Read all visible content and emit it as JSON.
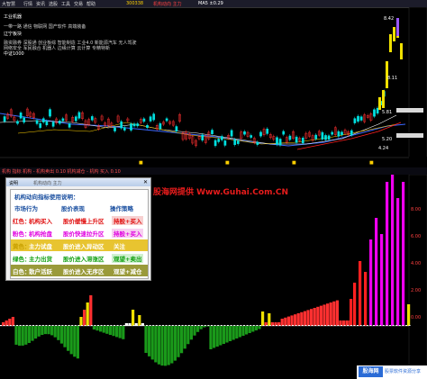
{
  "topbar": {
    "items": [
      "大智慧",
      "行情",
      "资讯",
      "选股",
      "工具",
      "交易",
      "帮助"
    ],
    "stock_code": "300338",
    "info": "机构动向 主力",
    "right_info": "MA5 ±0.29"
  },
  "upper": {
    "labels": [
      {
        "text": "工业机器",
        "color": "#ffffff"
      },
      {
        "text": "辽宁板块",
        "color": "#ffffff"
      },
      {
        "text": "中证1000",
        "color": "#ffffff"
      }
    ],
    "tag_lines": [
      "一带一路 通信 物联网 国产软件 高端装备",
      "融资融券 深股通 创业板综 智能制造 工业4.0 新能源汽车 无人驾驶",
      "网络安全 军民融合 机器人 边缘计算 云计算 专精特新"
    ],
    "price_labels": {
      "high": "8.42",
      "p1": "8.11",
      "p2": "5.81",
      "p3": "5.20",
      "low": "4.24"
    }
  },
  "sub_bar": {
    "text": "机构 指标  机构 -   机构卖出 0.10  机构减仓 -   机构 买入 0.10",
    "mini_label": "机构动向"
  },
  "dialog": {
    "title": "说明",
    "title_extra": "机构动向 主力",
    "header_line": "机构动向指标使用说明：",
    "col_heads": [
      "市场行为",
      "股价表现",
      "操作策略"
    ],
    "rows": [
      {
        "tag": "红色：",
        "behavior": "机构买入",
        "price": "股价缓慢上升区",
        "strategy": "持股+买入",
        "color": "#e01010",
        "bg": "#ffffff",
        "strategy_bg": "#f7d0d0"
      },
      {
        "tag": "粉色：",
        "behavior": "机构抢盘",
        "price": "股价快速拉升区",
        "strategy": "持股+买入",
        "color": "#e000e0",
        "bg": "#ffffff",
        "strategy_bg": "#f7d0f0"
      },
      {
        "tag": "黄色：",
        "behavior": "主力试盘",
        "price": "股价进入异动区",
        "strategy": "关注",
        "color": "#c8a000",
        "bg": "#e8c430",
        "strategy_bg": "#e8c430"
      },
      {
        "tag": "绿色：",
        "behavior": "主力出货",
        "price": "股价进入滞涨区",
        "strategy": "观望+卖出",
        "color": "#10a010",
        "bg": "#ffffff",
        "strategy_bg": "#d0f0d0"
      },
      {
        "tag": "白色：",
        "behavior": "散户活跃",
        "price": "股价进入无序区",
        "strategy": "观望+减仓",
        "color": "#ffffff",
        "bg": "#9a9a3a",
        "strategy_bg": "#9a9a3a"
      }
    ]
  },
  "watermark": "股海网提供 Www.Guhai.Com.CN",
  "logo": {
    "brand": "股海网",
    "subtitle": "股票软件资源分享",
    "url": "www.Guhai.com.cn"
  },
  "right_axis": [
    "8.00",
    "6.00",
    "4.00",
    "2.00",
    "0.00"
  ],
  "colors": {
    "red": "#e01010",
    "pink": "#f000f0",
    "yellow": "#f0e000",
    "green": "#10a010",
    "white": "#ffffff",
    "cyan": "#00c8c8"
  }
}
